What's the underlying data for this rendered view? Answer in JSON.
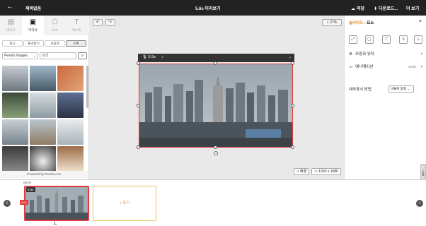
{
  "app": {
    "doc_title": "제목없음",
    "center_title": "5.6s 미리보기",
    "save": "저장",
    "download": "다운로드...",
    "more": "더 보기"
  },
  "left_tabs": [
    {
      "label": "비디오",
      "icon": "film-icon"
    },
    {
      "label": "미디어",
      "icon": "image-icon"
    },
    {
      "label": "요소",
      "icon": "shapes-icon"
    },
    {
      "label": "텍스트",
      "icon": "text-icon"
    }
  ],
  "sub_tabs": [
    "최근",
    "즐겨찾기",
    "사용자",
    "스톡"
  ],
  "filter": {
    "source": "Pexels Images",
    "search_placeholder": "검색"
  },
  "powered_by": "Powered by Pexels.com",
  "canvas": {
    "zoom": "27%",
    "clip_duration": "5.5s",
    "resolution": "1920 x 1080",
    "bg_button": "배경"
  },
  "right_panel": {
    "crumb_link": "슬라이드",
    "crumb_current": "요소",
    "props": [
      {
        "label": "모양과 위치",
        "value": ""
      },
      {
        "label": "애니메이션",
        "value": "auto"
      }
    ],
    "scale_label": "내부표시 방법",
    "scale_value": "비율에 맞춰",
    "side_tab": "도움"
  },
  "timeline": {
    "time": "00:00",
    "clip_duration": "5.5s",
    "clip_badge": "5.0s",
    "clip_number": "1.",
    "add_label": "+ 추가"
  }
}
